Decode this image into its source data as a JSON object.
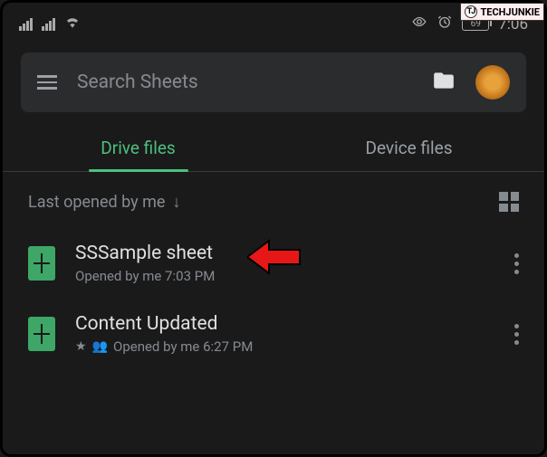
{
  "watermark": {
    "prefix": "TJ",
    "text": "TECHJUNKIE"
  },
  "status_bar": {
    "battery_level": "69",
    "time": "7:06"
  },
  "search": {
    "placeholder": "Search Sheets"
  },
  "tabs": {
    "drive": "Drive files",
    "device": "Device files"
  },
  "sort": {
    "label": "Last opened by me"
  },
  "files": [
    {
      "title": "SSSample sheet",
      "meta": "Opened by me 7:03 PM",
      "starred": false,
      "shared": false
    },
    {
      "title": "Content Updated",
      "meta": "Opened by me 6:27 PM",
      "starred": true,
      "shared": true
    }
  ]
}
